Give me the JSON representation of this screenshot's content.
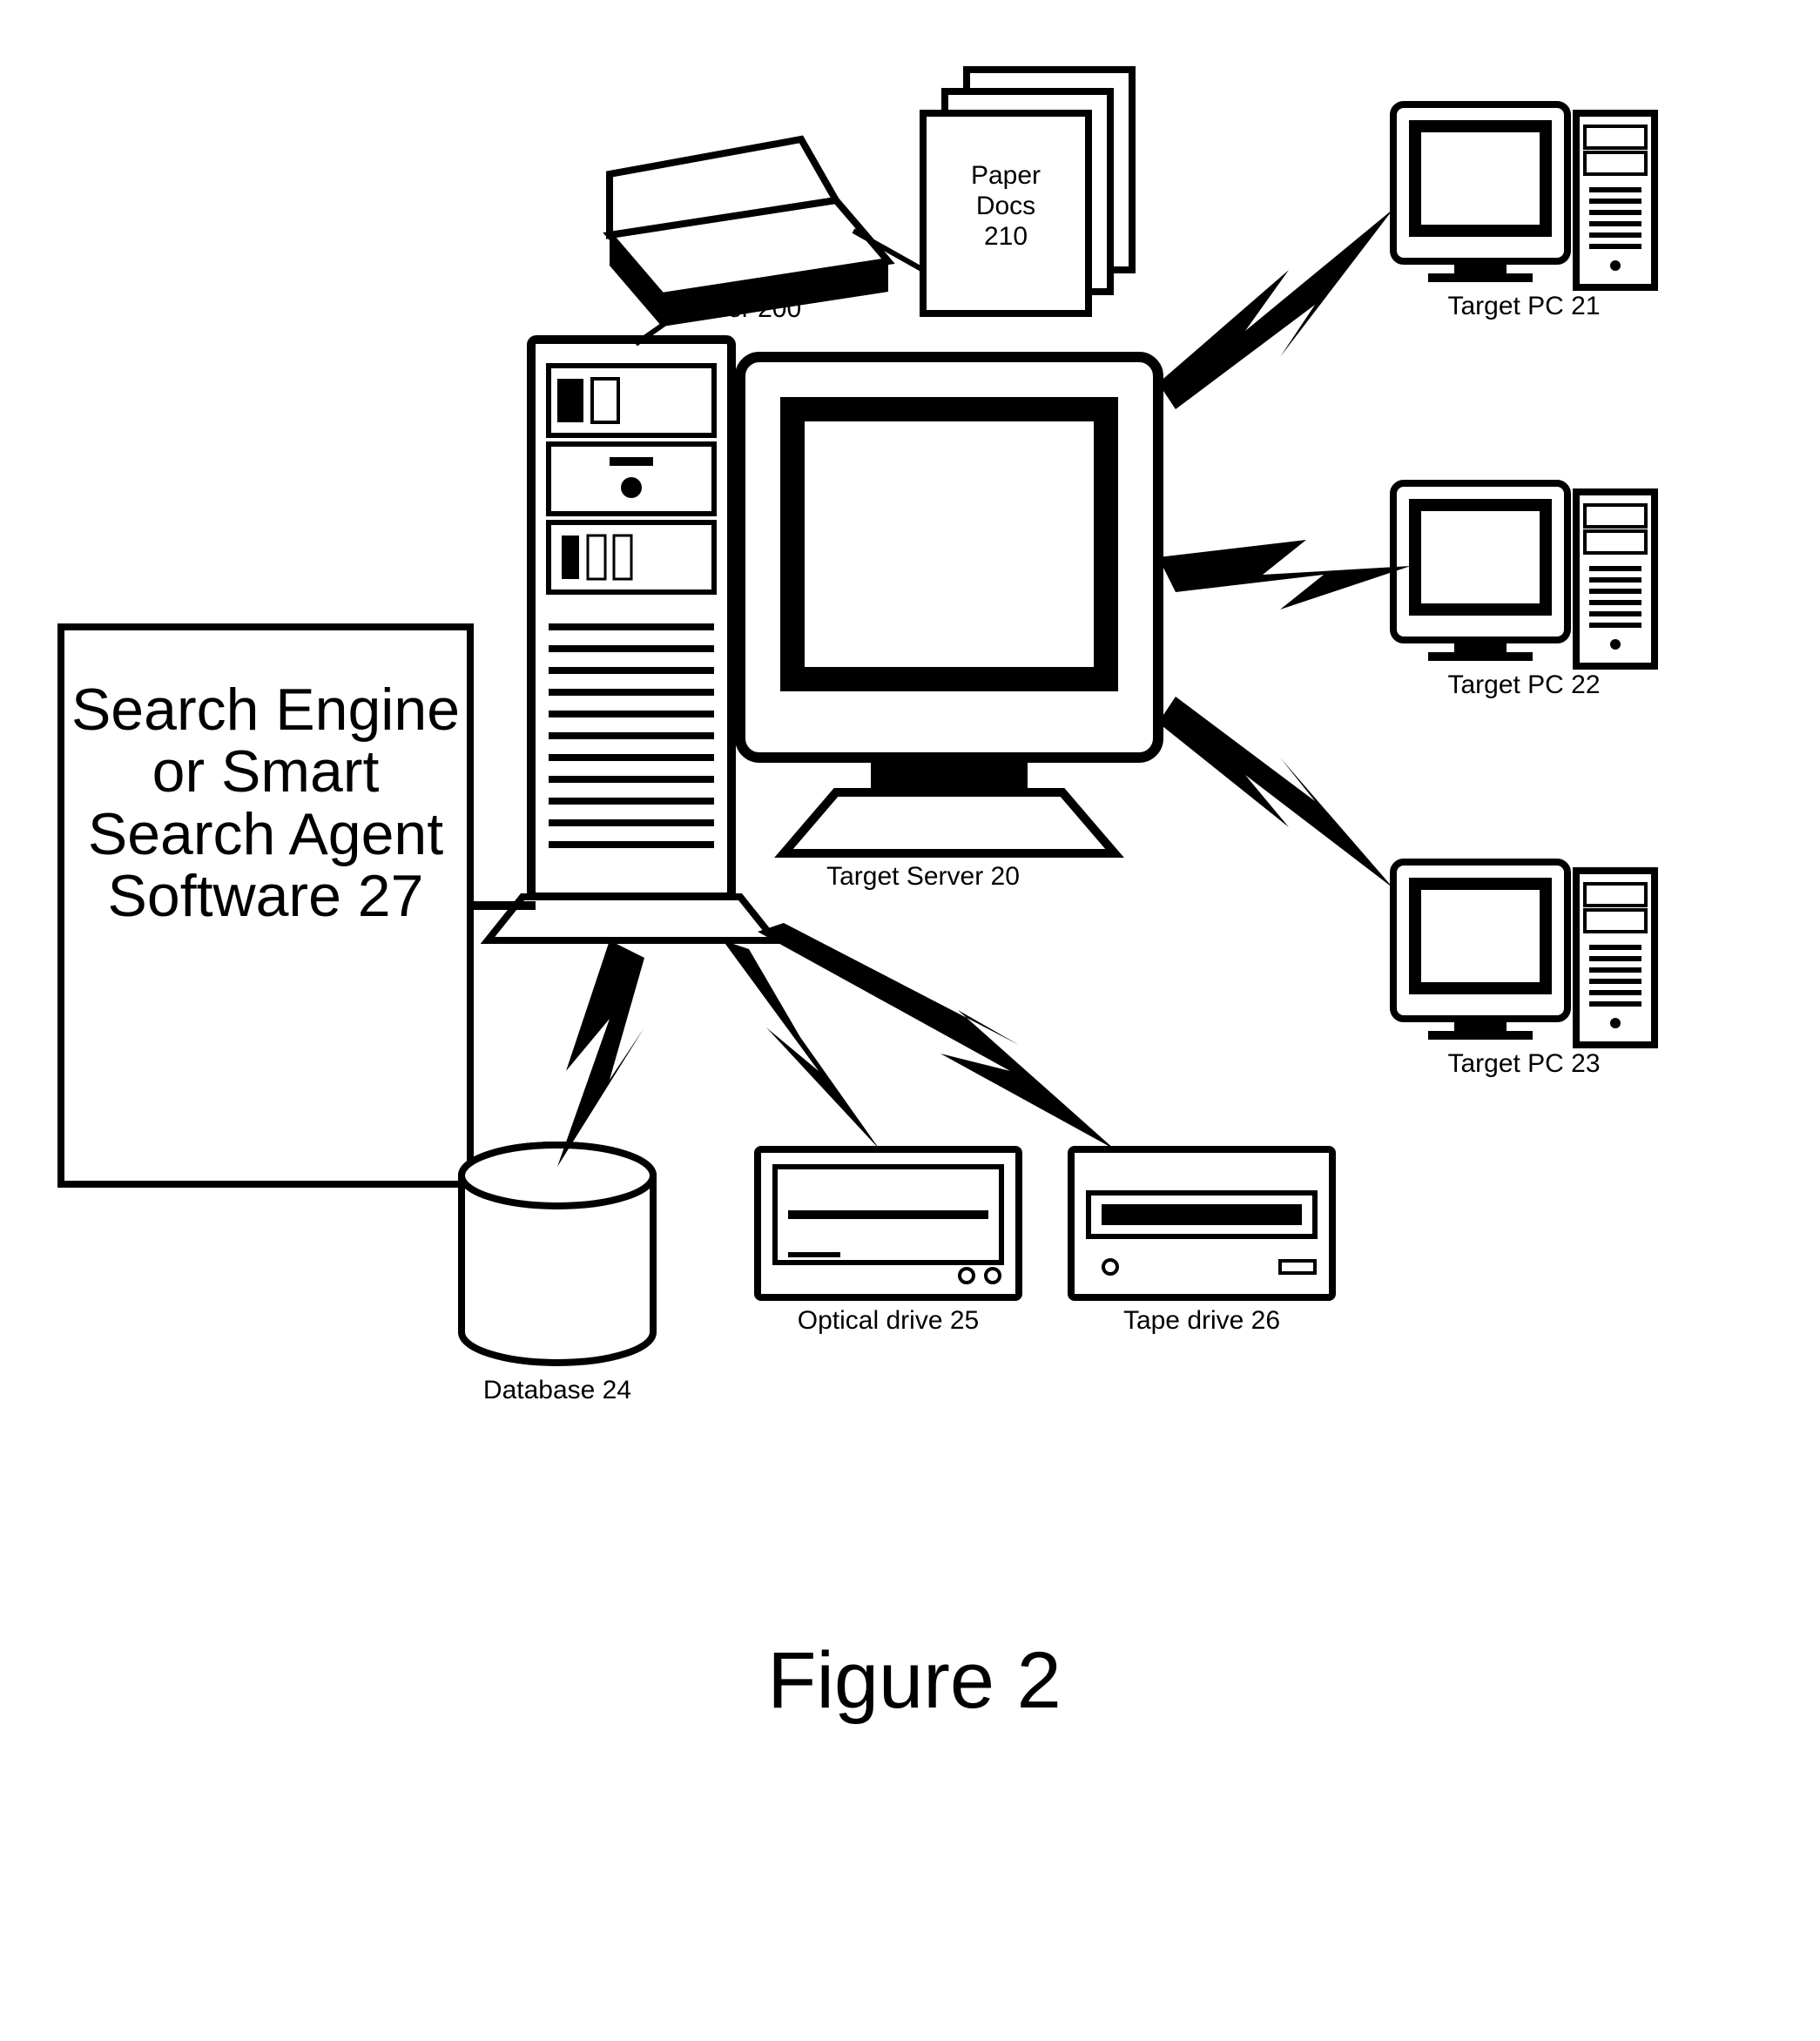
{
  "figure_title": "Figure 2",
  "labels": {
    "search_box": "Search Engine or Smart Search Agent Software 27",
    "scanner": "Scanner 200",
    "paper_docs_l1": "Paper",
    "paper_docs_l2": "Docs",
    "paper_docs_l3": "210",
    "target_server": "Target Server 20",
    "database": "Database 24",
    "optical_drive": "Optical drive 25",
    "tape_drive": "Tape drive 26",
    "pc21": "Target PC 21",
    "pc22": "Target PC 22",
    "pc23": "Target PC 23"
  }
}
